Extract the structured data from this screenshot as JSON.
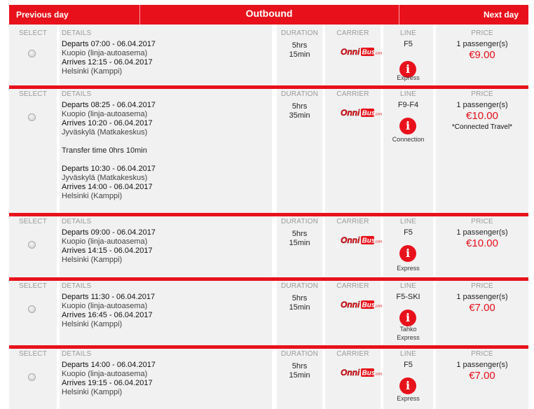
{
  "header": {
    "previous_day": "Previous day",
    "title": "Outbound",
    "next_day": "Next day"
  },
  "columns": {
    "select": "SELECT",
    "details": "DETAILS",
    "duration": "DURATION",
    "carrier": "CARRIER",
    "line": "LINE",
    "price": "PRICE"
  },
  "carrier_logo": {
    "text": "OnniBus.com",
    "icon": "onnibus-logo",
    "color": "#e8111b"
  },
  "colors": {
    "accent": "#e8111b",
    "cell_bg": "#f1f1f1",
    "header_text": "#9a9a9a"
  },
  "info_icon": "info-icon",
  "trips": [
    {
      "segments": [
        {
          "departs": "Departs 07:00 - 06.04.2017",
          "from": "Kuopio (linja-autoasema)",
          "arrives": "Arrives 12:15 - 06.04.2017",
          "to": "Helsinki (Kamppi)"
        }
      ],
      "transfer": "",
      "duration_hrs": "5hrs",
      "duration_min": "15min",
      "line": "F5",
      "line_type": [
        "Express"
      ],
      "passengers": "1 passenger(s)",
      "price": "€9.00",
      "note": ""
    },
    {
      "segments": [
        {
          "departs": "Departs 08:25 - 06.04.2017",
          "from": "Kuopio (linja-autoasema)",
          "arrives": "Arrives 10:20 - 06.04.2017",
          "to": "Jyväskylä (Matkakeskus)"
        },
        {
          "departs": "Departs 10:30 - 06.04.2017",
          "from": "Jyväskylä (Matkakeskus)",
          "arrives": "Arrives 14:00 - 06.04.2017",
          "to": "Helsinki (Kamppi)"
        }
      ],
      "transfer": "Transfer time 0hrs 10min",
      "duration_hrs": "5hrs",
      "duration_min": "35min",
      "line": "F9-F4",
      "line_type": [
        "Connection"
      ],
      "passengers": "1 passenger(s)",
      "price": "€10.00",
      "note": "*Connected Travel*"
    },
    {
      "segments": [
        {
          "departs": "Departs 09:00 - 06.04.2017",
          "from": "Kuopio (linja-autoasema)",
          "arrives": "Arrives 14:15 - 06.04.2017",
          "to": "Helsinki (Kamppi)"
        }
      ],
      "transfer": "",
      "duration_hrs": "5hrs",
      "duration_min": "15min",
      "line": "F5",
      "line_type": [
        "Express"
      ],
      "passengers": "1 passenger(s)",
      "price": "€10.00",
      "note": ""
    },
    {
      "segments": [
        {
          "departs": "Departs 11:30 - 06.04.2017",
          "from": "Kuopio (linja-autoasema)",
          "arrives": "Arrives 16:45 - 06.04.2017",
          "to": "Helsinki (Kamppi)"
        }
      ],
      "transfer": "",
      "duration_hrs": "5hrs",
      "duration_min": "15min",
      "line": "F5-SKI",
      "line_type": [
        "Tahko",
        "Express"
      ],
      "passengers": "1 passenger(s)",
      "price": "€7.00",
      "note": ""
    },
    {
      "segments": [
        {
          "departs": "Departs 14:00 - 06.04.2017",
          "from": "Kuopio (linja-autoasema)",
          "arrives": "Arrives 19:15 - 06.04.2017",
          "to": "Helsinki (Kamppi)"
        }
      ],
      "transfer": "",
      "duration_hrs": "5hrs",
      "duration_min": "15min",
      "line": "F5",
      "line_type": [
        "Express"
      ],
      "passengers": "1 passenger(s)",
      "price": "€7.00",
      "note": ""
    }
  ]
}
